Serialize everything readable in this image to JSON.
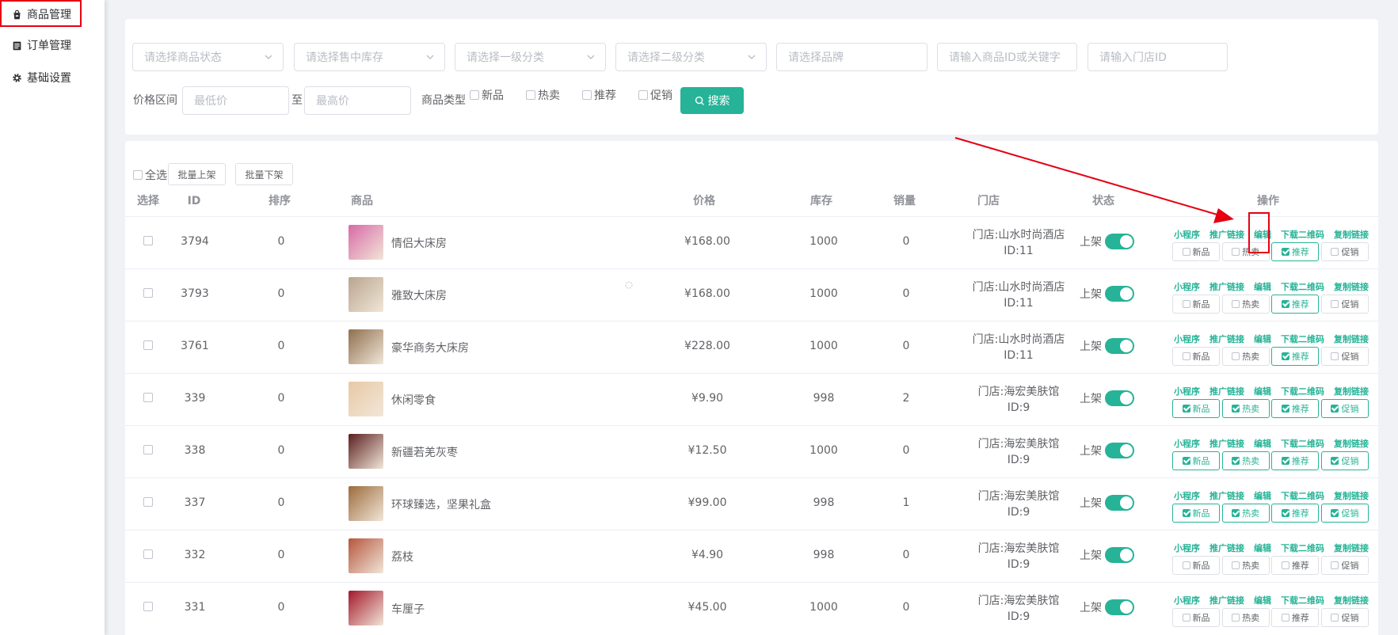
{
  "sidebar": {
    "items": [
      {
        "label": "商品管理",
        "icon": "bag-icon"
      },
      {
        "label": "订单管理",
        "icon": "clipboard-icon"
      },
      {
        "label": "基础设置",
        "icon": "gear-icon"
      }
    ]
  },
  "filters": {
    "status_placeholder": "请选择商品状态",
    "stock_placeholder": "请选择售中库存",
    "cat1_placeholder": "请选择一级分类",
    "cat2_placeholder": "请选择二级分类",
    "brand_placeholder": "请选择品牌",
    "keyword_placeholder": "请输入商品ID或关键字",
    "store_placeholder": "请输入门店ID",
    "price_label": "价格区间",
    "min_placeholder": "最低价",
    "to_label": "至",
    "max_placeholder": "最高价",
    "type_label": "商品类型",
    "types": [
      "新品",
      "热卖",
      "推荐",
      "促销"
    ],
    "search_label": "搜索"
  },
  "toolbar": {
    "select_all": "全选",
    "batch_on": "批量上架",
    "batch_off": "批量下架"
  },
  "columns": [
    "选择",
    "ID",
    "排序",
    "商品",
    "价格",
    "库存",
    "销量",
    "门店",
    "状态",
    "操作"
  ],
  "action_links": [
    "小程序",
    "推广链接",
    "编辑",
    "下载二维码",
    "复制链接"
  ],
  "tag_labels": [
    "新品",
    "热卖",
    "推荐",
    "促销"
  ],
  "rows": [
    {
      "id": "3794",
      "sort": "0",
      "name": "情侣大床房",
      "price": "¥168.00",
      "stock": "1000",
      "sales": "0",
      "store": "门店:山水时尚酒店",
      "store_id": "ID:11",
      "status": "上架",
      "tags": [
        false,
        false,
        true,
        false
      ],
      "thumb": "#d86aa6"
    },
    {
      "id": "3793",
      "sort": "0",
      "name": "雅致大床房",
      "price": "¥168.00",
      "stock": "1000",
      "sales": "0",
      "store": "门店:山水时尚酒店",
      "store_id": "ID:11",
      "status": "上架",
      "tags": [
        false,
        false,
        true,
        false
      ],
      "thumb": "#b9a48e"
    },
    {
      "id": "3761",
      "sort": "0",
      "name": "豪华商务大床房",
      "price": "¥228.00",
      "stock": "1000",
      "sales": "0",
      "store": "门店:山水时尚酒店",
      "store_id": "ID:11",
      "status": "上架",
      "tags": [
        false,
        false,
        true,
        false
      ],
      "thumb": "#8f6f4e"
    },
    {
      "id": "339",
      "sort": "0",
      "name": "休闲零食",
      "price": "¥9.90",
      "stock": "998",
      "sales": "2",
      "store": "门店:海宏美肤馆",
      "store_id": "ID:9",
      "status": "上架",
      "tags": [
        true,
        true,
        true,
        true
      ],
      "thumb": "#e8c9a6"
    },
    {
      "id": "338",
      "sort": "0",
      "name": "新疆若羌灰枣",
      "price": "¥12.50",
      "stock": "1000",
      "sales": "0",
      "store": "门店:海宏美肤馆",
      "store_id": "ID:9",
      "status": "上架",
      "tags": [
        true,
        true,
        true,
        true
      ],
      "thumb": "#5a1f1f"
    },
    {
      "id": "337",
      "sort": "0",
      "name": "环球臻选，坚果礼盒",
      "price": "¥99.00",
      "stock": "998",
      "sales": "1",
      "store": "门店:海宏美肤馆",
      "store_id": "ID:9",
      "status": "上架",
      "tags": [
        true,
        true,
        true,
        true
      ],
      "thumb": "#9c6b3c"
    },
    {
      "id": "332",
      "sort": "0",
      "name": "荔枝",
      "price": "¥4.90",
      "stock": "998",
      "sales": "0",
      "store": "门店:海宏美肤馆",
      "store_id": "ID:9",
      "status": "上架",
      "tags": [
        false,
        false,
        false,
        false
      ],
      "thumb": "#b5563e"
    },
    {
      "id": "331",
      "sort": "0",
      "name": "车厘子",
      "price": "¥45.00",
      "stock": "1000",
      "sales": "0",
      "store": "门店:海宏美肤馆",
      "store_id": "ID:9",
      "status": "上架",
      "tags": [
        false,
        false,
        false,
        false
      ],
      "thumb": "#a3182a"
    }
  ],
  "colors": {
    "accent": "#26b397",
    "annotation": "#e60012"
  }
}
